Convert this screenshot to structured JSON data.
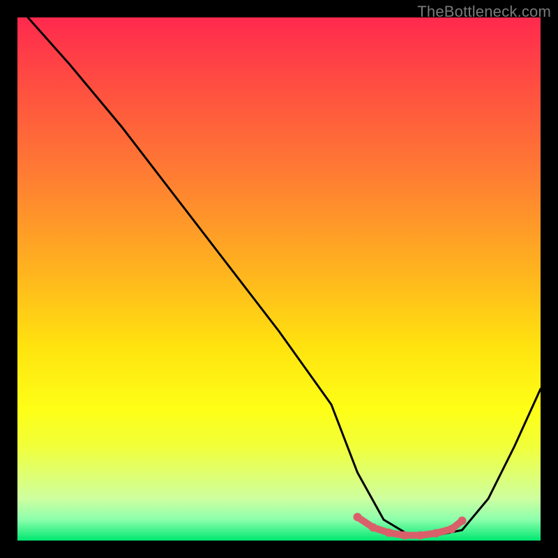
{
  "watermark": "TheBottleneck.com",
  "chart_data": {
    "type": "line",
    "title": "",
    "xlabel": "",
    "ylabel": "",
    "xlim": [
      0,
      100
    ],
    "ylim": [
      0,
      100
    ],
    "series": [
      {
        "name": "bottleneck-curve",
        "x": [
          2,
          10,
          20,
          30,
          40,
          50,
          60,
          65,
          70,
          75,
          80,
          85,
          90,
          95,
          100
        ],
        "y": [
          100,
          91,
          79,
          66,
          53,
          40,
          26,
          13,
          4,
          1,
          1,
          2,
          8,
          18,
          29
        ]
      }
    ],
    "highlight": {
      "name": "optimal-range",
      "x": [
        65,
        68,
        71,
        74,
        77,
        80,
        83,
        85
      ],
      "y": [
        4.5,
        2.5,
        1.5,
        1.0,
        1.0,
        1.4,
        2.2,
        3.8
      ]
    },
    "colors": {
      "curve": "#000000",
      "highlight": "#d9606a"
    }
  }
}
